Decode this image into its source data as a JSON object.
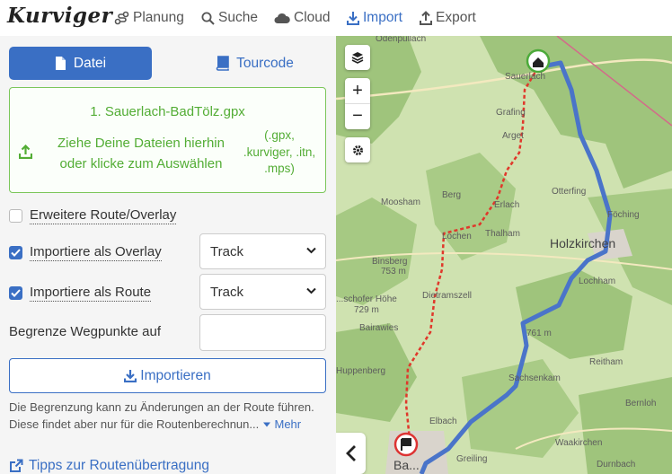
{
  "app": {
    "logo_text": "Kurviger"
  },
  "nav": {
    "items": [
      {
        "label": "Planung",
        "icon": "route-icon"
      },
      {
        "label": "Suche",
        "icon": "search-icon"
      },
      {
        "label": "Cloud",
        "icon": "cloud-icon"
      },
      {
        "label": "Import",
        "icon": "download-icon",
        "active": true
      },
      {
        "label": "Export",
        "icon": "upload-icon"
      }
    ],
    "active_color": "#3a6fc4"
  },
  "tabs": {
    "datei": "Datei",
    "tourcode": "Tourcode"
  },
  "dropzone": {
    "filename": "1. Sauerlach-BadTölz.gpx",
    "line1": "Ziehe Deine Dateien hierhin",
    "line2": "oder klicke zum Auswählen",
    "ext1": "(.gpx,",
    "ext2": ".kurviger, .itn,",
    "ext3": ".mps)",
    "color": "#53ad35"
  },
  "options": {
    "extended_label": "Erweitere Route/Overlay",
    "extended_checked": false,
    "overlay_label": "Importiere als Overlay",
    "overlay_checked": true,
    "overlay_select": "Track",
    "route_label": "Importiere als Route",
    "route_checked": true,
    "route_select": "Track",
    "limit_label": "Begrenze Wegpunkte auf",
    "limit_value": ""
  },
  "import_button": "Importieren",
  "note": {
    "text": "Die Begrenzung kann zu Änderungen an der Route führen. Diese findet aber nur für die Routenberechnun...",
    "more": "Mehr"
  },
  "tips_link": "Tipps zur Routenübertragung",
  "map": {
    "zoom_in": "+",
    "zoom_out": "−",
    "labels": {
      "odenpullach": "Odenpullach",
      "sauerlach": "Sauerlach",
      "grafing": "Grafing",
      "arget": "Arget",
      "otterfing": "Otterfing",
      "berg": "Berg",
      "moosham": "Moosham",
      "erlach": "Erlach",
      "foching": "Föching",
      "holzkirchen": "Holzkirchen",
      "thalham": "Thalham",
      "lochen": "Lochen",
      "binsberg": "Binsberg",
      "h753": "753 m",
      "lochham": "Lochham",
      "dietramszell": "Dietramszell",
      "schoefer": "...schofer Höhe",
      "h729": "729 m",
      "bairawies": "Bairawies",
      "h761": "761 m",
      "huppenberg": "Huppenberg",
      "sachsenkam": "Sachsenkam",
      "reitham": "Reitham",
      "bernloh": "Bernloh",
      "elbach": "Elbach",
      "greiling": "Greiling",
      "waakirchen": "Waakirchen",
      "durnbach": "Durnbach",
      "bad": "Ba..."
    }
  }
}
